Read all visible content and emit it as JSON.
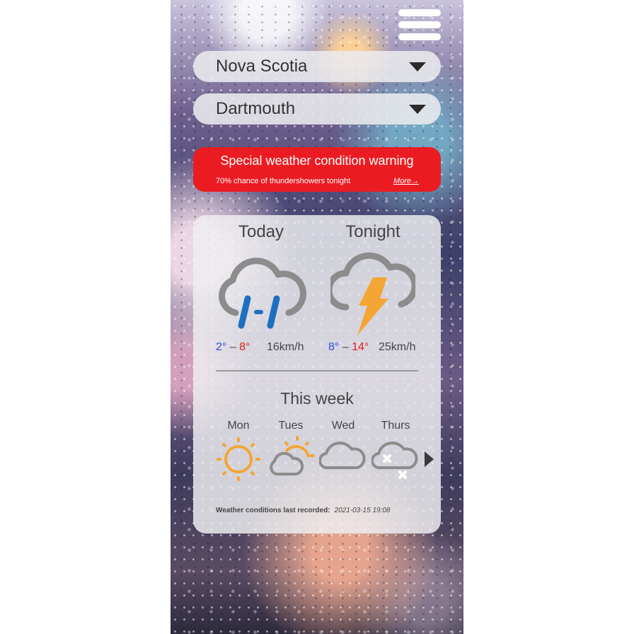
{
  "header": {
    "menu_icon": "hamburger-menu-icon"
  },
  "province_select": {
    "value": "Nova Scotia",
    "icon": "caret-down-icon"
  },
  "city_select": {
    "value": "Dartmouth",
    "icon": "caret-down-icon"
  },
  "warning": {
    "title": "Special weather condition warning",
    "detail": "70% chance of thundershowers tonight",
    "more_label": "More→",
    "color": "#ea1c22"
  },
  "forecast": {
    "today": {
      "label": "Today",
      "icon": "rain-cloud-icon",
      "low": "2°",
      "high": "8°",
      "sep": "–",
      "wind": "16km/h"
    },
    "tonight": {
      "label": "Tonight",
      "icon": "thunderstorm-icon",
      "low": "8°",
      "high": "14°",
      "sep": "–",
      "wind": "25km/h"
    }
  },
  "week": {
    "title": "This week",
    "days": [
      {
        "label": "Mon",
        "icon": "sun-icon"
      },
      {
        "label": "Tues",
        "icon": "partly-cloudy-icon"
      },
      {
        "label": "Wed",
        "icon": "cloud-icon"
      },
      {
        "label": "Thurs",
        "icon": "snow-cloud-icon"
      }
    ],
    "next_icon": "chevron-right-icon"
  },
  "footer": {
    "recorded_label": "Weather conditions last recorded:",
    "recorded_time": "2021-03-15 19:08"
  },
  "colors": {
    "low_temp": "#2a4fd6",
    "high_temp": "#e01b1b",
    "sun": "#f3a633",
    "rain": "#1e6fc0",
    "icon_gray": "#8c8c8c"
  }
}
